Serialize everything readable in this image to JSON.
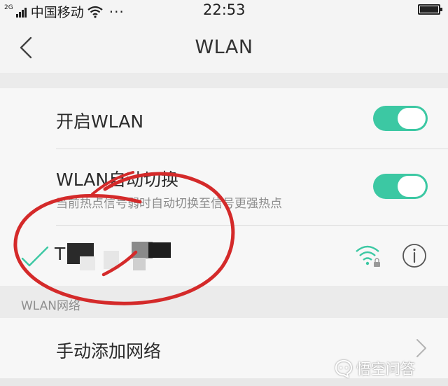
{
  "status_bar": {
    "network_type": "2G",
    "carrier": "中国移动",
    "overflow_dots": "···",
    "time": "22:53",
    "icons": [
      "signal-icon",
      "wifi-icon",
      "battery-icon"
    ]
  },
  "nav": {
    "back_icon": "chevron-left-icon",
    "title": "WLAN"
  },
  "settings": {
    "enable_wlan": {
      "label": "开启WLAN",
      "enabled": true
    },
    "auto_switch": {
      "label": "WLAN自动切换",
      "description": "当前热点信号弱时自动切换至信号更强热点",
      "enabled": true
    }
  },
  "connected_network": {
    "ssid_visible": "T",
    "connected_icon": "check-icon",
    "signal_icon": "wifi-lock-icon",
    "info_icon": "info-icon"
  },
  "networks_section": {
    "header": "WLAN网络",
    "add_network_label": "手动添加网络",
    "arrow_icon": "chevron-right-icon"
  },
  "watermark": {
    "text": "悟空问答"
  },
  "colors": {
    "toggle_on": "#3cc8a3",
    "accent_teal": "#3cc8a3",
    "annotation_red": "#d42a2a",
    "background": "#f0f0f0"
  }
}
